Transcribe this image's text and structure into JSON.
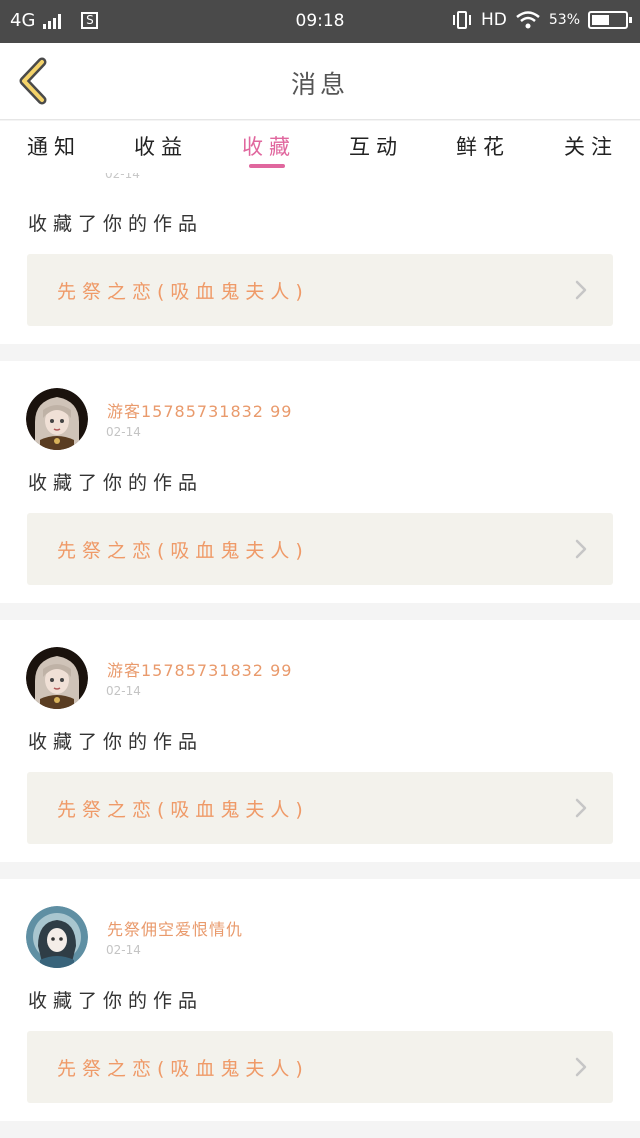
{
  "status_bar": {
    "network": "4G",
    "app_badge": "S",
    "time": "09:18",
    "hd": "HD",
    "battery_text": "53%",
    "battery_level": 0.53
  },
  "header": {
    "title": "消息",
    "back_icon": "chevron-left-icon"
  },
  "tabs": [
    {
      "label": "通知"
    },
    {
      "label": "收益"
    },
    {
      "label": "收藏",
      "active": true
    },
    {
      "label": "互动"
    },
    {
      "label": "鲜花"
    },
    {
      "label": "关注"
    }
  ],
  "items": [
    {
      "date": "02-14",
      "action": "收藏了你的作品",
      "work_title": "先祭之恋(吸血鬼夫人)"
    },
    {
      "user": "游客15785731832 99",
      "date": "02-14",
      "action": "收藏了你的作品",
      "work_title": "先祭之恋(吸血鬼夫人)",
      "avatar": "gothic-doll-avatar"
    },
    {
      "user": "游客15785731832 99",
      "date": "02-14",
      "action": "收藏了你的作品",
      "work_title": "先祭之恋(吸血鬼夫人)",
      "avatar": "gothic-doll-avatar"
    },
    {
      "user": "先祭佣空爱恨情仇",
      "date": "02-14",
      "action": "收藏了你的作品",
      "work_title": "先祭之恋(吸血鬼夫人)",
      "avatar": "blue-girl-avatar"
    }
  ],
  "colors": {
    "accent": "#e0679e",
    "name": "#e99a6c",
    "work_title": "#ef9a68",
    "work_bg": "#f3f2ec",
    "status_bar": "#4a4a4a"
  }
}
